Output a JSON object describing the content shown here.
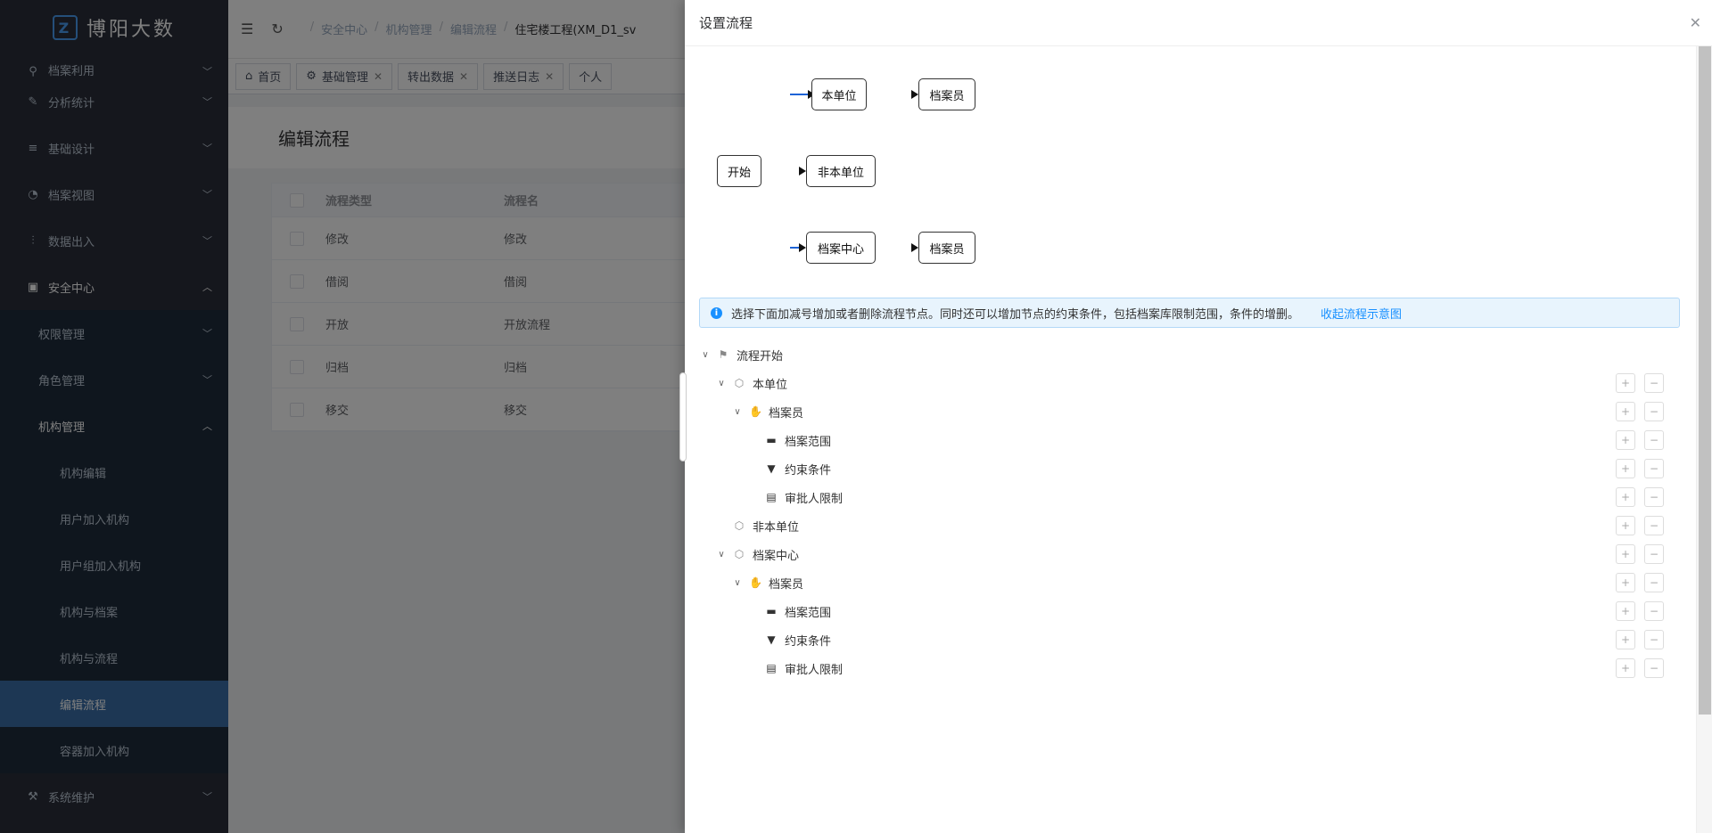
{
  "sidebar": {
    "logo": "博阳大数",
    "items": [
      {
        "label": "档案利用",
        "icon": "search-icon",
        "glyph": "⚲"
      },
      {
        "label": "分析统计",
        "icon": "edit-icon",
        "glyph": "✎"
      },
      {
        "label": "基础设计",
        "icon": "list-icon",
        "glyph": "≡"
      },
      {
        "label": "档案视图",
        "icon": "dashboard-icon",
        "glyph": "◔"
      },
      {
        "label": "数据出入",
        "icon": "sliders-icon",
        "glyph": "⫶"
      },
      {
        "label": "安全中心",
        "icon": "lock-icon",
        "glyph": "▣"
      }
    ],
    "sub_items": [
      "权限管理",
      "角色管理",
      "机构管理"
    ],
    "org_items": [
      "机构编辑",
      "用户加入机构",
      "用户组加入机构",
      "机构与档案",
      "机构与流程",
      "编辑流程",
      "容器加入机构"
    ],
    "footer_item": {
      "label": "系统维护",
      "icon": "wrench-icon",
      "glyph": "⚒"
    }
  },
  "topbar": {
    "breadcrumb": [
      "安全中心",
      "机构管理",
      "编辑流程",
      "住宅楼工程(XM_D1_sv"
    ]
  },
  "tabs": [
    {
      "label": "首页",
      "closable": false
    },
    {
      "label": "基础管理",
      "closable": true
    },
    {
      "label": "转出数据",
      "closable": true
    },
    {
      "label": "推送日志",
      "closable": true
    },
    {
      "label": "个人",
      "closable": false
    }
  ],
  "page": {
    "title": "编辑流程",
    "columns": [
      "流程类型",
      "流程名"
    ],
    "rows": [
      [
        "修改",
        "修改"
      ],
      [
        "借阅",
        "借阅"
      ],
      [
        "开放",
        "开放流程"
      ],
      [
        "归档",
        "归档"
      ],
      [
        "移交",
        "移交"
      ]
    ]
  },
  "drawer": {
    "title": "设置流程",
    "diagram": {
      "start": "开始",
      "branch1": "本单位",
      "branch1_role": "档案员",
      "branch2": "非本单位",
      "branch3": "档案中心",
      "branch3_role": "档案员"
    },
    "alert_text": "选择下面加减号增加或者删除流程节点。同时还可以增加节点的约束条件，包括档案库限制范围，条件的增删。",
    "alert_link": "收起流程示意图",
    "tree": [
      {
        "label": "流程开始",
        "level": 0,
        "toggle": "⌄",
        "icon": "flag-icon",
        "glyph": "⚑",
        "controls": false
      },
      {
        "label": "本单位",
        "level": 1,
        "toggle": "⌄",
        "icon": "cube-icon",
        "glyph": "⬡",
        "controls": true
      },
      {
        "label": "档案员",
        "level": 2,
        "toggle": "⌄",
        "icon": "hand-icon",
        "glyph": "✋",
        "controls": true
      },
      {
        "label": "档案范围",
        "level": 3,
        "toggle": "",
        "icon": "folder-icon",
        "glyph": "▬",
        "controls": true
      },
      {
        "label": "约束条件",
        "level": 3,
        "toggle": "",
        "icon": "filter-icon",
        "glyph": "▼",
        "controls": true
      },
      {
        "label": "审批人限制",
        "level": 3,
        "toggle": "",
        "icon": "table-icon",
        "glyph": "▤",
        "controls": true
      },
      {
        "label": "非本单位",
        "level": 1,
        "toggle": "",
        "icon": "cube-icon",
        "glyph": "⬡",
        "controls": true
      },
      {
        "label": "档案中心",
        "level": 1,
        "toggle": "⌄",
        "icon": "cube-icon",
        "glyph": "⬡",
        "controls": true
      },
      {
        "label": "档案员",
        "level": 2,
        "toggle": "⌄",
        "icon": "hand-icon",
        "glyph": "✋",
        "controls": true
      },
      {
        "label": "档案范围",
        "level": 3,
        "toggle": "",
        "icon": "folder-icon",
        "glyph": "▬",
        "controls": true
      },
      {
        "label": "约束条件",
        "level": 3,
        "toggle": "",
        "icon": "filter-icon",
        "glyph": "▼",
        "controls": true
      },
      {
        "label": "审批人限制",
        "level": 3,
        "toggle": "",
        "icon": "table-icon",
        "glyph": "▤",
        "controls": true
      }
    ],
    "plus": "+",
    "minus": "−"
  },
  "colors": {
    "sidebar_bg": "#2b2f3a",
    "active": "#3a6fa8",
    "link": "#1890ff"
  }
}
